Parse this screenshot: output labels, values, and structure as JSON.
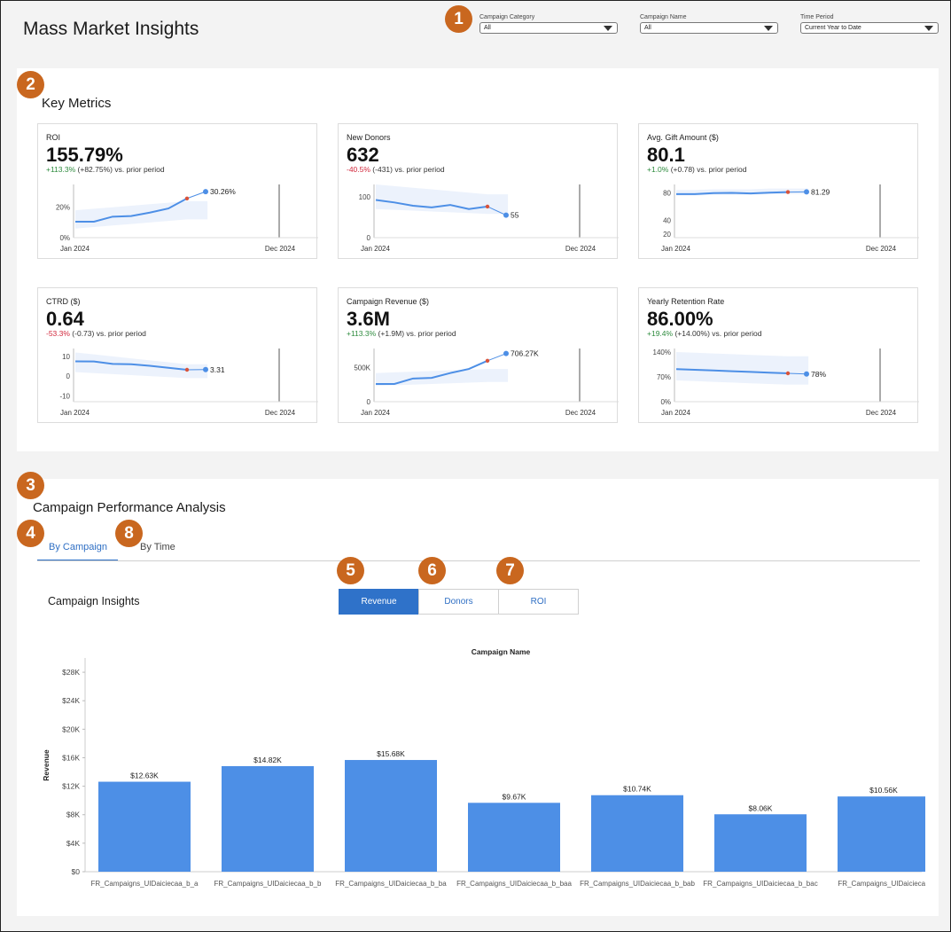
{
  "page": {
    "title": "Mass Market Insights"
  },
  "badges": [
    "1",
    "2",
    "3",
    "4",
    "5",
    "6",
    "7",
    "8"
  ],
  "filters": [
    {
      "label": "Campaign Category",
      "value": "All"
    },
    {
      "label": "Campaign Name",
      "value": "All"
    },
    {
      "label": "Time Period",
      "value": "Current Year to Date"
    }
  ],
  "key_metrics": {
    "title": "Key Metrics",
    "cards": [
      {
        "title": "ROI",
        "value": "155.79%",
        "delta_pct": "+113.3%",
        "delta_rest": " (+82.75%) vs. prior period",
        "trend": "up",
        "chart": {
          "start": "Jan 2024",
          "end": "Dec 2024",
          "last_label": "30.26%",
          "ticks": [
            "20%",
            "0%"
          ],
          "ylim": [
            0,
            35
          ],
          "tick_values": [
            20,
            0
          ],
          "values": [
            10.5,
            10.5,
            13.8,
            14.2,
            16.5,
            19.2,
            25.8
          ],
          "last": 30.26,
          "band": [
            [
              6,
              18
            ],
            [
              7,
              19
            ],
            [
              8,
              20
            ],
            [
              9,
              21
            ],
            [
              10,
              22
            ],
            [
              11,
              23
            ],
            [
              12,
              24
            ]
          ]
        }
      },
      {
        "title": "New Donors",
        "value": "632",
        "delta_pct": "-40.5%",
        "delta_rest": " (-431) vs. prior period",
        "trend": "down",
        "chart": {
          "start": "Jan 2024",
          "end": "Dec 2024",
          "last_label": "55",
          "ticks": [
            "100",
            "0"
          ],
          "ylim": [
            0,
            130
          ],
          "tick_values": [
            100,
            0
          ],
          "values": [
            92,
            86,
            78,
            74,
            80,
            70,
            76
          ],
          "last": 55,
          "band": [
            [
              70,
              130
            ],
            [
              68,
              126
            ],
            [
              66,
              122
            ],
            [
              64,
              118
            ],
            [
              62,
              114
            ],
            [
              60,
              110
            ],
            [
              58,
              106
            ]
          ]
        }
      },
      {
        "title": "Avg. Gift Amount ($)",
        "value": "80.1",
        "delta_pct": "+1.0%",
        "delta_rest": " (+0.78) vs. prior period",
        "trend": "up",
        "chart": {
          "start": "Jan 2024",
          "end": "Dec 2024",
          "last_label": "81.29",
          "ticks": [
            "80",
            "40",
            "20"
          ],
          "ylim": [
            15,
            92
          ],
          "tick_values": [
            80,
            40,
            20
          ],
          "values": [
            78,
            78,
            79.5,
            79.8,
            79,
            80.2,
            81
          ],
          "last": 81.29,
          "band": [
            [
              76,
              84
            ],
            [
              76,
              84
            ],
            [
              77,
              85
            ],
            [
              77,
              85
            ],
            [
              77,
              85
            ],
            [
              78,
              86
            ],
            [
              78,
              86
            ]
          ]
        }
      },
      {
        "title": "CTRD ($)",
        "value": "0.64",
        "delta_pct": "-53.3%",
        "delta_rest": " (-0.73) vs. prior period",
        "trend": "down",
        "chart": {
          "start": "Jan 2024",
          "end": "Dec 2024",
          "last_label": "3.31",
          "ticks": [
            "10",
            "0",
            "-10"
          ],
          "ylim": [
            -13,
            14
          ],
          "tick_values": [
            10,
            0,
            -10
          ],
          "values": [
            7.5,
            7.4,
            6.2,
            6.0,
            5.2,
            4.2,
            3.2
          ],
          "last": 3.31,
          "band": [
            [
              2,
              12
            ],
            [
              1.5,
              11
            ],
            [
              1,
              10
            ],
            [
              0.5,
              9
            ],
            [
              0,
              8
            ],
            [
              -0.5,
              7
            ],
            [
              -1,
              6
            ]
          ]
        }
      },
      {
        "title": "Campaign Revenue ($)",
        "value": "3.6M",
        "delta_pct": "+113.3%",
        "delta_rest": " (+1.9M) vs. prior period",
        "trend": "up",
        "chart": {
          "start": "Jan 2024",
          "end": "Dec 2024",
          "last_label": "706.27K",
          "ticks": [
            "500K",
            "0"
          ],
          "ylim": [
            0,
            780
          ],
          "tick_values": [
            500,
            0
          ],
          "values": [
            260,
            260,
            340,
            350,
            420,
            480,
            600
          ],
          "last": 706.27,
          "band": [
            [
              230,
              420
            ],
            [
              240,
              430
            ],
            [
              250,
              440
            ],
            [
              260,
              450
            ],
            [
              270,
              460
            ],
            [
              280,
              470
            ],
            [
              290,
              480
            ]
          ]
        }
      },
      {
        "title": "Yearly Retention Rate",
        "value": "86.00%",
        "delta_pct": "+19.4%",
        "delta_rest": " (+14.00%) vs. prior period",
        "trend": "up",
        "chart": {
          "start": "Jan 2024",
          "end": "Dec 2024",
          "last_label": "78%",
          "ticks": [
            "140%",
            "70%",
            "0%"
          ],
          "ylim": [
            0,
            150
          ],
          "tick_values": [
            140,
            70,
            0
          ],
          "values": [
            92,
            90,
            88,
            86,
            84,
            82,
            80
          ],
          "last": 78,
          "band": [
            [
              60,
              140
            ],
            [
              58,
              138
            ],
            [
              56,
              136
            ],
            [
              54,
              134
            ],
            [
              52,
              132
            ],
            [
              50,
              130
            ],
            [
              48,
              128
            ]
          ]
        }
      }
    ]
  },
  "campaign_performance": {
    "title": "Campaign Performance Analysis",
    "tabs": [
      {
        "label": "By Campaign",
        "active": true
      },
      {
        "label": "By Time",
        "active": false
      }
    ],
    "insights_title": "Campaign Insights",
    "segments": [
      {
        "label": "Revenue",
        "active": true
      },
      {
        "label": "Donors",
        "active": false
      },
      {
        "label": "ROI",
        "active": false
      }
    ]
  },
  "chart_data": {
    "type": "bar",
    "title": "Campaign Name",
    "xlabel": "",
    "ylabel": "Revenue",
    "ylim": [
      0,
      30000
    ],
    "yticks": [
      "$28K",
      "$24K",
      "$20K",
      "$16K",
      "$12K",
      "$8K",
      "$4K",
      "$0"
    ],
    "ytick_values": [
      28000,
      24000,
      20000,
      16000,
      12000,
      8000,
      4000,
      0
    ],
    "categories": [
      "FR_Campaigns_UIDaiciecaa_b_a",
      "FR_Campaigns_UIDaiciecaa_b_b",
      "FR_Campaigns_UIDaiciecaa_b_ba",
      "FR_Campaigns_UIDaiciecaa_b_baa",
      "FR_Campaigns_UIDaiciecaa_b_bab",
      "FR_Campaigns_UIDaiciecaa_b_bac",
      "FR_Campaigns_UIDaiciecaa"
    ],
    "values": [
      12630,
      14820,
      15680,
      9670,
      10740,
      8060,
      10560
    ],
    "labels": [
      "$12.63K",
      "$14.82K",
      "$15.68K",
      "$9.67K",
      "$10.74K",
      "$8.06K",
      "$10.56K"
    ],
    "grid": true,
    "color": "#4d8fe6"
  },
  "colors": {
    "accent": "#2f72c9",
    "badge": "#c9671f",
    "line": "#4d8fe6",
    "marker_red": "#d9533a",
    "up": "#2e8b3e",
    "down": "#d2283c"
  }
}
